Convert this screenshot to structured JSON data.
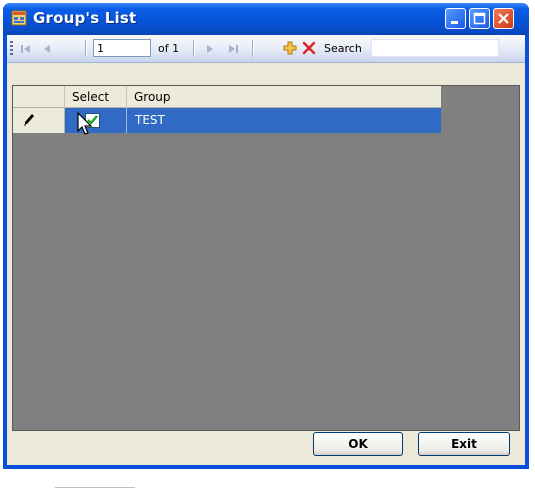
{
  "window": {
    "title": "Group's List",
    "icon": "app-form-icon"
  },
  "toolbar": {
    "position_value": "1",
    "of_label": "of 1",
    "search_label": "Search",
    "search_value": "",
    "icons": [
      "move-first-icon",
      "move-previous-icon",
      "move-next-icon",
      "move-last-icon",
      "add-new-icon",
      "delete-icon"
    ]
  },
  "grid": {
    "columns": [
      "Select",
      "Group"
    ],
    "rows": [
      {
        "select": true,
        "group": "TEST",
        "selected": true,
        "editing": true
      }
    ],
    "selection_color": "#316ac5",
    "background_color": "#808080"
  },
  "buttons": {
    "ok": "OK",
    "exit": "Exit"
  }
}
